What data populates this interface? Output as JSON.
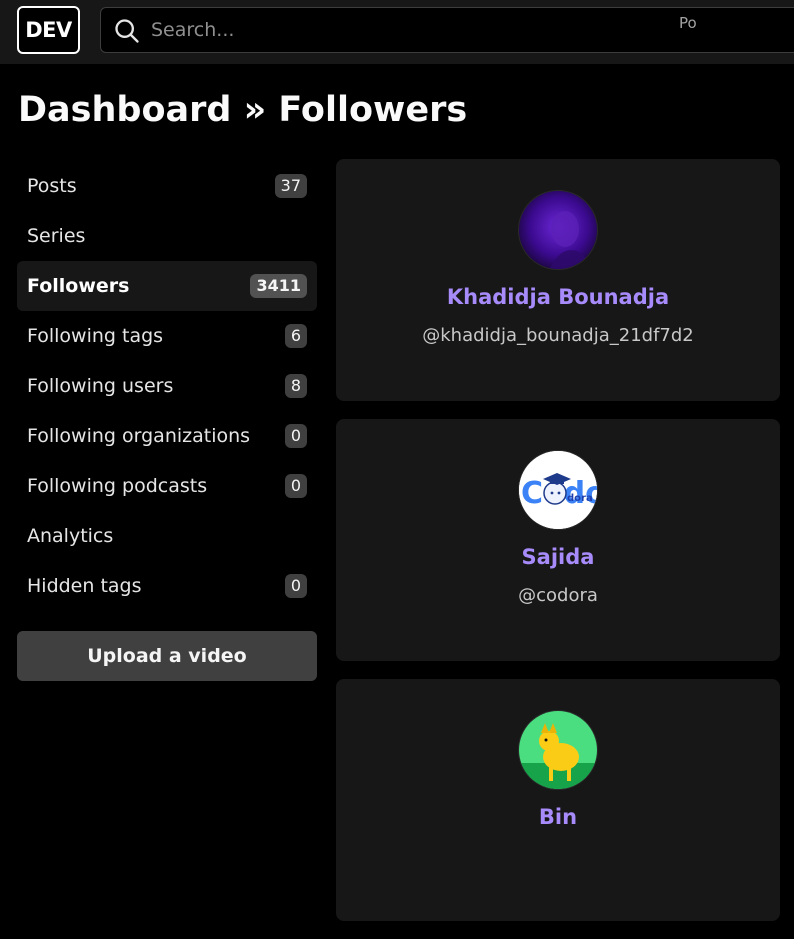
{
  "header": {
    "logo_text": "DEV",
    "search_placeholder": "Search...",
    "search_hint": "Po"
  },
  "page": {
    "title": "Dashboard » Followers"
  },
  "sidebar": {
    "items": [
      {
        "label": "Posts",
        "count": "37"
      },
      {
        "label": "Series",
        "count": null
      },
      {
        "label": "Followers",
        "count": "3411",
        "active": true
      },
      {
        "label": "Following tags",
        "count": "6"
      },
      {
        "label": "Following users",
        "count": "8"
      },
      {
        "label": "Following organizations",
        "count": "0"
      },
      {
        "label": "Following podcasts",
        "count": "0"
      },
      {
        "label": "Analytics",
        "count": null
      },
      {
        "label": "Hidden tags",
        "count": "0"
      }
    ],
    "upload_label": "Upload a video"
  },
  "followers": [
    {
      "name": "Khadidja Bounadja",
      "handle": "@khadidja_bounadja_21df7d2",
      "avatar": "purple-portrait-avatar"
    },
    {
      "name": "Sajida",
      "handle": "@codora",
      "avatar": "codora-logo-avatar",
      "avatar_text": "Codora"
    },
    {
      "name": "Bin",
      "handle": "",
      "avatar": "dog-avatar"
    }
  ],
  "colors": {
    "accent_name": "#a78bfa",
    "background": "#000000",
    "card": "#171717"
  }
}
